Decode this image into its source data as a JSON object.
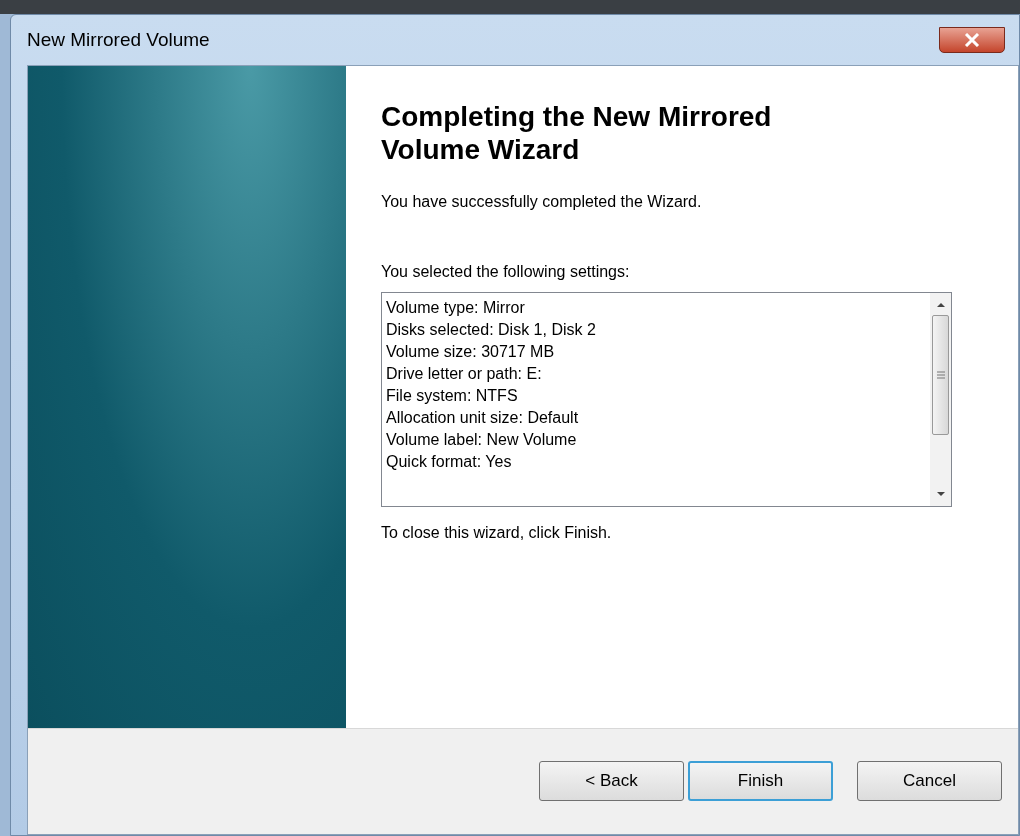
{
  "window": {
    "title": "New Mirrored Volume"
  },
  "wizard": {
    "heading": "Completing the New Mirrored Volume Wizard",
    "intro": "You have successfully completed the Wizard.",
    "settings_label": "You selected the following settings:",
    "settings": [
      "Volume type: Mirror",
      "Disks selected: Disk 1, Disk 2",
      "Volume size: 30717 MB",
      "Drive letter or path: E:",
      "File system: NTFS",
      "Allocation unit size: Default",
      "Volume label: New Volume",
      "Quick format: Yes"
    ],
    "closing": "To close this wizard, click Finish."
  },
  "buttons": [
    {
      "label": "< Back",
      "default": false
    },
    {
      "label": "Finish",
      "default": true
    },
    {
      "label": "Cancel",
      "default": false
    }
  ]
}
